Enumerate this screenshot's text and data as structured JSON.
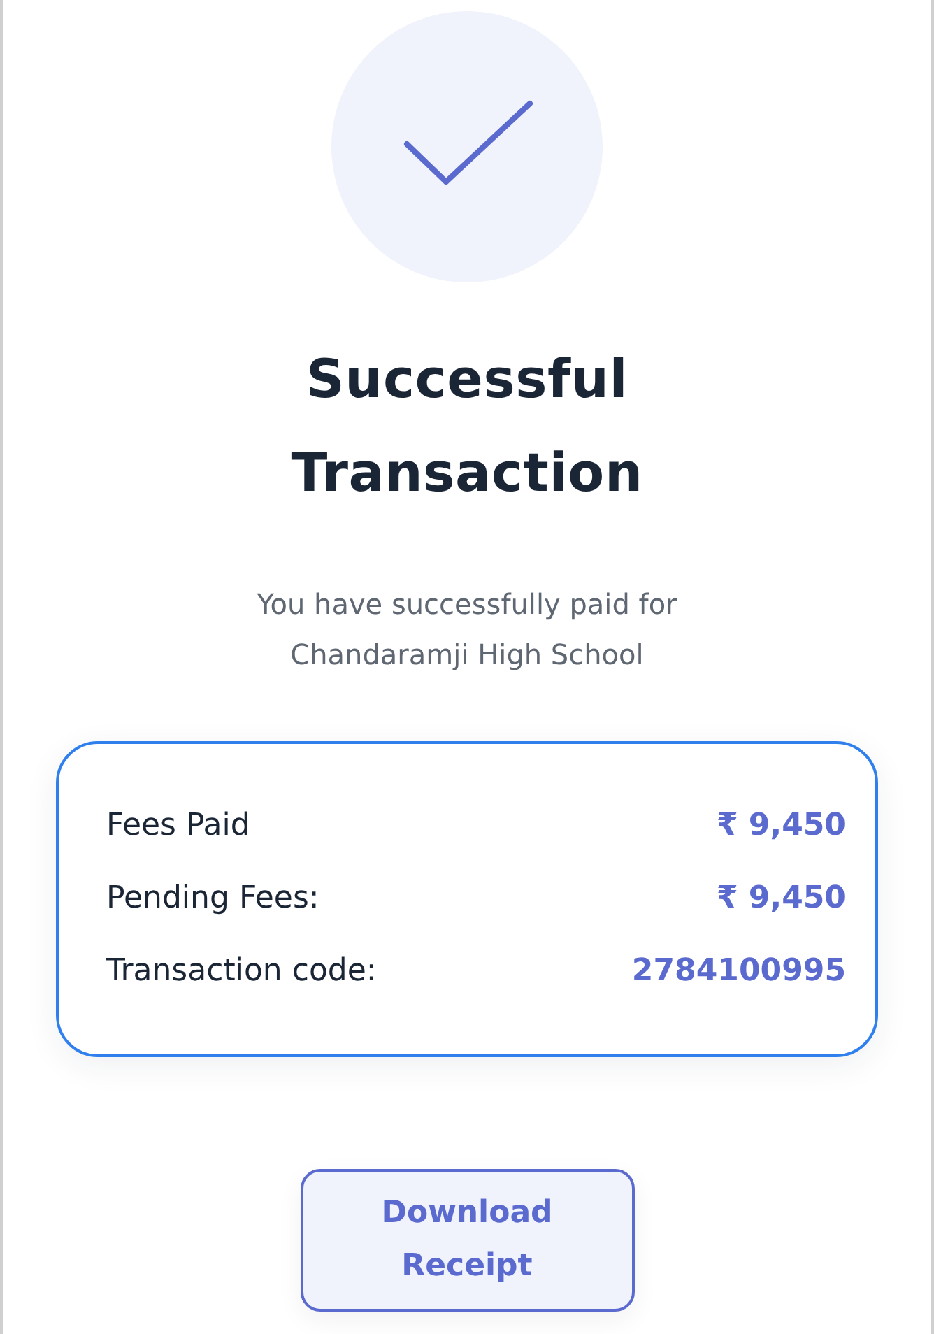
{
  "status": {
    "kind": "success"
  },
  "title": "Successful Transaction",
  "message": "You have successfully paid for Chandaramji High School",
  "details": [
    {
      "label": "Fees Paid",
      "value": "₹ 9,450"
    },
    {
      "label": "Pending Fees:",
      "value": "₹ 9,450"
    },
    {
      "label": "Transaction code:",
      "value": "2784100995"
    }
  ],
  "buttons": [
    {
      "label": "Download Receipt"
    }
  ]
}
